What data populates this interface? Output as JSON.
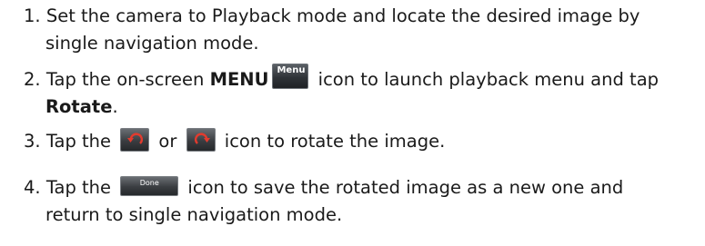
{
  "steps": [
    {
      "num": "1.",
      "line1": "Set the camera to Playback mode and locate the desired image by",
      "line2": "single navigation mode."
    },
    {
      "num": "2.",
      "pre": "Tap the on-screen ",
      "bold1": "MENU",
      "icon_label": "Menu",
      "post": " icon to launch playback menu and tap",
      "bold2": "Rotate",
      "end": "."
    },
    {
      "num": "3.",
      "pre": "Tap the ",
      "mid": " or ",
      "post": " icon to rotate the image."
    },
    {
      "num": "4.",
      "pre": "Tap the ",
      "icon_label": "Done",
      "post": " icon to save the rotated image as a new one and",
      "line2": "return to single navigation mode."
    }
  ],
  "icons": {
    "menu": "menu-icon",
    "rotate_left": "rotate-left-icon",
    "rotate_right": "rotate-right-icon",
    "done": "done-button-icon"
  },
  "colors": {
    "text": "#1a1a1a",
    "icon_bg": "#3a3d41",
    "icon_fg": "#ffffff",
    "arrow": "#e23b2e"
  }
}
